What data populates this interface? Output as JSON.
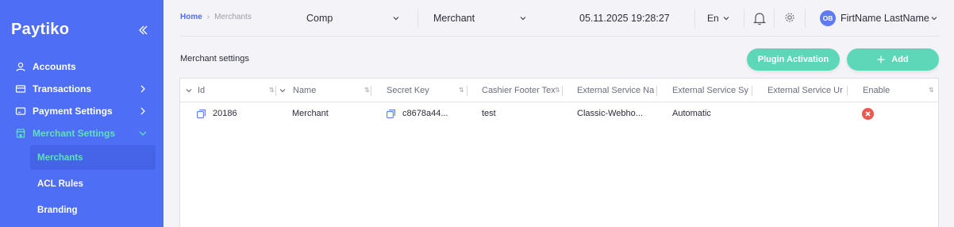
{
  "sidebar": {
    "brand": "Paytiko",
    "items": [
      {
        "label": "Accounts"
      },
      {
        "label": "Transactions"
      },
      {
        "label": "Payment Settings"
      },
      {
        "label": "Merchant Settings"
      }
    ],
    "subitems": [
      {
        "label": "Merchants"
      },
      {
        "label": "ACL Rules"
      },
      {
        "label": "Branding"
      }
    ]
  },
  "header": {
    "breadcrumb": {
      "home": "Home",
      "separator": "›",
      "current": "Merchants"
    },
    "company_select": "Comp",
    "merchant_select": "Merchant",
    "datetime": "05.11.2025 19:28:27",
    "language": "En",
    "user_initials": "OB",
    "user_name": "FirtName LastName"
  },
  "toolbar": {
    "title": "Merchant settings",
    "plugin_label": "Plugin Activation",
    "add_label": "Add"
  },
  "table": {
    "columns": [
      "Id",
      "Name",
      "Secret Key",
      "Cashier Footer Tex",
      "External Service Na",
      "External Service Sy",
      "External Service Ur",
      "Enable"
    ],
    "rows": [
      {
        "id": "20186",
        "name": "Merchant",
        "secret_key": "c8678a44...",
        "cashier_footer": "test",
        "ext_name": "Classic-Webho...",
        "ext_sync": "Automatic",
        "ext_url": "",
        "enable": "disabled"
      }
    ]
  },
  "colors": {
    "sidebar": "#4e6ef5",
    "accent": "#5cd8b8",
    "active_text": "#5de0c1",
    "disabled": "#e85a4f"
  }
}
